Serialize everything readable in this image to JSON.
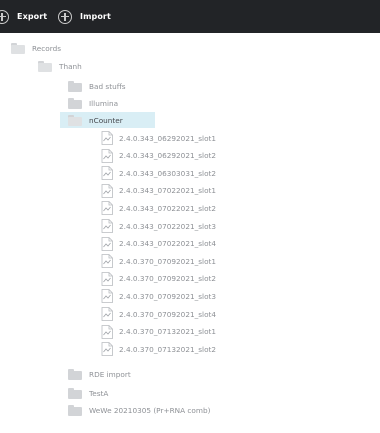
{
  "toolbar": {
    "export_label": "Export",
    "import_label": "Import",
    "export_icon": "plus-circle-icon",
    "import_icon": "plus-circle-icon"
  },
  "tree": {
    "root": "Records",
    "user": "Thanh",
    "folders_before": [
      "Bad stuffs",
      "Illumina"
    ],
    "selected_folder": "nCounter",
    "files": [
      "2.4.0.343_06292021_slot1",
      "2.4.0.343_06292021_slot2",
      "2.4.0.343_06303031_slot2",
      "2.4.0.343_07022021_slot1",
      "2.4.0.343_07022021_slot2",
      "2.4.0.343_07022021_slot3",
      "2.4.0.343_07022021_slot4",
      "2.4.0.370_07092021_slot1",
      "2.4.0.370_07092021_slot2",
      "2.4.0.370_07092021_slot3",
      "2.4.0.370_07092021_slot4",
      "2.4.0.370_07132021_slot1",
      "2.4.0.370_07132021_slot2"
    ],
    "folders_after": [
      "RDE import",
      "TestA",
      "WeWe 20210305 (Pr+RNA comb)"
    ]
  },
  "colors": {
    "toolbar_bg": "#222427",
    "selection_bg": "#d9eef5",
    "text": "#8e9196",
    "folder_icon": "#d2d4d7"
  }
}
